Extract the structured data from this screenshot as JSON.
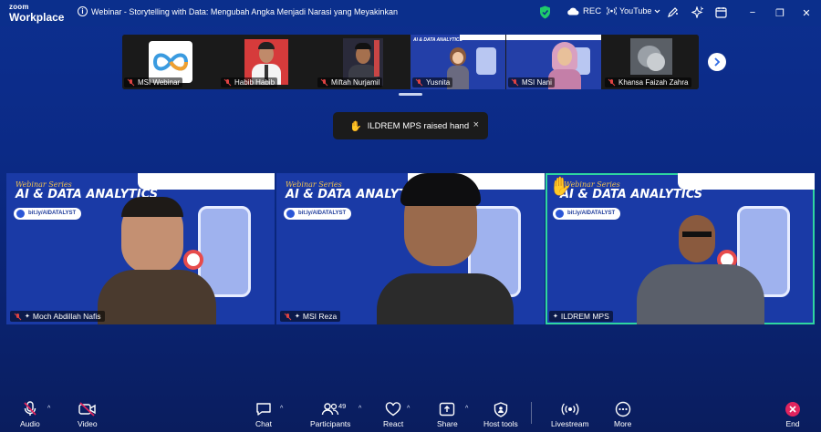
{
  "window": {
    "brand_small": "zoom",
    "brand_big": "Workplace",
    "meeting_title": "Webinar - Storytelling with Data: Mengubah Angka Menjadi Narasi yang Meyakinkan",
    "rec_label": "REC",
    "youtube_label": "YouTube",
    "minimize": "−",
    "restore": "❐",
    "close": "✕"
  },
  "filmstrip": {
    "tiles": [
      {
        "name": "MSI Webinar"
      },
      {
        "name": "Habib Habib"
      },
      {
        "name": "Miftah Nurjamil"
      },
      {
        "name": "Yusnita"
      },
      {
        "name": "MSI Nani"
      },
      {
        "name": "Khansa Faizah Zahra"
      }
    ],
    "mini_slide_title": "AI & DATA ANALYTICS"
  },
  "toast": {
    "text": "ILDREM MPS raised hand",
    "close": "×"
  },
  "videos": [
    {
      "name": "Moch Abdillah Nafis"
    },
    {
      "name": "MSI Reza"
    },
    {
      "name": "ILDREM MPS"
    }
  ],
  "slide": {
    "series": "Webinar Series",
    "title": "AI & DATA ANALYTICS",
    "link": "bit.ly/AIDATALYST"
  },
  "toolbar": {
    "audio": "Audio",
    "video": "Video",
    "chat": "Chat",
    "participants": "Participants",
    "participants_count": "49",
    "react": "React",
    "share": "Share",
    "host_tools": "Host tools",
    "livestream": "Livestream",
    "more": "More",
    "end": "End"
  },
  "colors": {
    "background": "#0b2a86",
    "active_speaker": "#2fd6a0",
    "end_red": "#e0245e",
    "shield_green": "#1fcb6b"
  }
}
